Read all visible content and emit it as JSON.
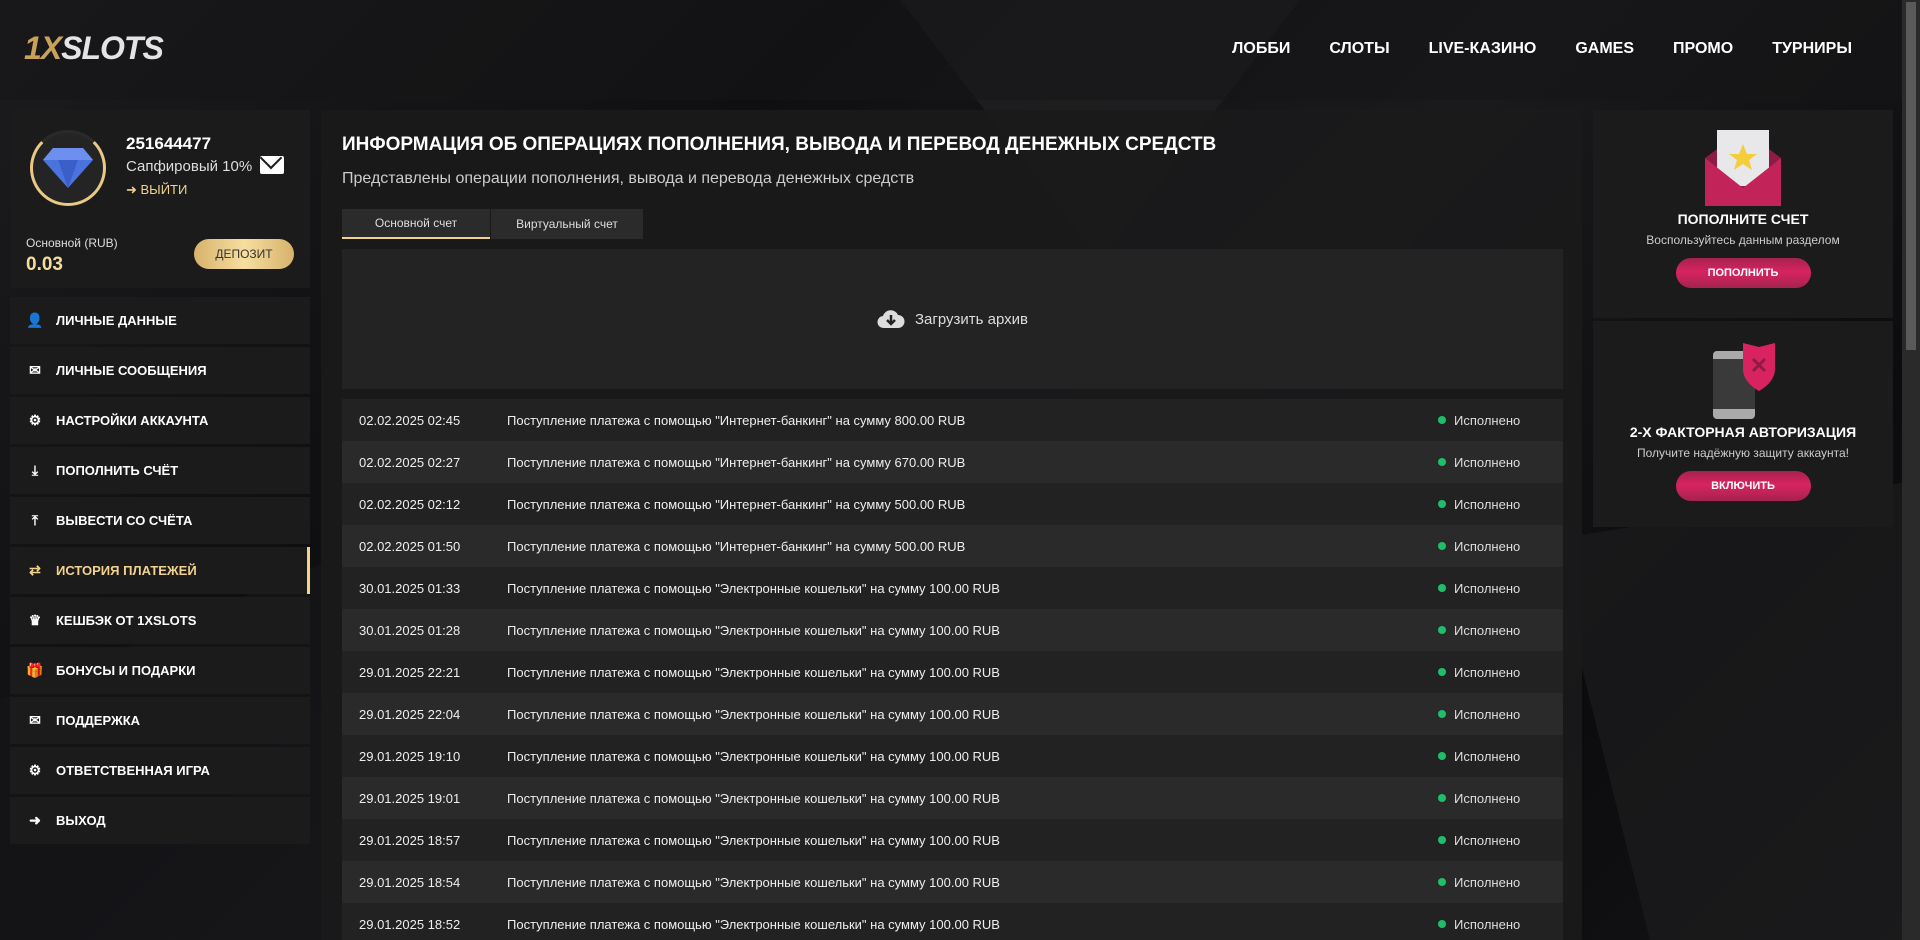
{
  "header": {
    "logo": "1XSLOTS",
    "nav": [
      "ЛОББИ",
      "СЛОТЫ",
      "LIVE-КАЗИНО",
      "GAMES",
      "ПРОМО",
      "ТУРНИРЫ"
    ]
  },
  "profile": {
    "user_id": "251644477",
    "tier": "Сапфировый 10%",
    "logout": "ВЫЙТИ",
    "balance_label": "Основной (RUB)",
    "balance": "0.03",
    "deposit": "ДЕПОЗИТ"
  },
  "menu": [
    {
      "label": "ЛИЧНЫЕ ДАННЫЕ",
      "icon": "user-plus-icon"
    },
    {
      "label": "ЛИЧНЫЕ СООБЩЕНИЯ",
      "icon": "envelope-icon"
    },
    {
      "label": "НАСТРОЙКИ АККАУНТА",
      "icon": "gears-icon"
    },
    {
      "label": "ПОПОЛНИТЬ СЧЁТ",
      "icon": "download-icon"
    },
    {
      "label": "ВЫВЕСТИ СО СЧЁТА",
      "icon": "upload-icon"
    },
    {
      "label": "ИСТОРИЯ ПЛАТЕЖЕЙ",
      "icon": "exchange-icon",
      "active": true
    },
    {
      "label": "КЕШБЭК ОТ 1XSLOTS",
      "icon": "crown-icon"
    },
    {
      "label": "БОНУСЫ И ПОДАРКИ",
      "icon": "gift-icon"
    },
    {
      "label": "ПОДДЕРЖКА",
      "icon": "envelope-icon"
    },
    {
      "label": "ОТВЕТСТВЕННАЯ ИГРА",
      "icon": "gears-icon"
    },
    {
      "label": "ВЫХОД",
      "icon": "sign-out-icon"
    }
  ],
  "main": {
    "title": "ИНФОРМАЦИЯ ОБ ОПЕРАЦИЯХ ПОПОЛНЕНИЯ, ВЫВОДА И ПЕРЕВОД ДЕНЕЖНЫХ СРЕДСТВ",
    "subtitle": "Представлены операции пополнения, вывода и перевода денежных средств",
    "tabs": [
      "Основной счет",
      "Виртуальный счет"
    ],
    "upload": "Загрузить архив",
    "rows": [
      {
        "date": "02.02.2025 02:45",
        "text": "Поступление платежа с помощью \"Интернет-банкинг\" на сумму 800.00 RUB",
        "status": "Исполнено"
      },
      {
        "date": "02.02.2025 02:27",
        "text": "Поступление платежа с помощью \"Интернет-банкинг\" на сумму 670.00 RUB",
        "status": "Исполнено"
      },
      {
        "date": "02.02.2025 02:12",
        "text": "Поступление платежа с помощью \"Интернет-банкинг\" на сумму 500.00 RUB",
        "status": "Исполнено"
      },
      {
        "date": "02.02.2025 01:50",
        "text": "Поступление платежа с помощью \"Интернет-банкинг\" на сумму 500.00 RUB",
        "status": "Исполнено"
      },
      {
        "date": "30.01.2025 01:33",
        "text": "Поступление платежа с помощью \"Электронные кошельки\" на сумму 100.00 RUB",
        "status": "Исполнено"
      },
      {
        "date": "30.01.2025 01:28",
        "text": "Поступление платежа с помощью \"Электронные кошельки\" на сумму 100.00 RUB",
        "status": "Исполнено"
      },
      {
        "date": "29.01.2025 22:21",
        "text": "Поступление платежа с помощью \"Электронные кошельки\" на сумму 100.00 RUB",
        "status": "Исполнено"
      },
      {
        "date": "29.01.2025 22:04",
        "text": "Поступление платежа с помощью \"Электронные кошельки\" на сумму 100.00 RUB",
        "status": "Исполнено"
      },
      {
        "date": "29.01.2025 19:10",
        "text": "Поступление платежа с помощью \"Электронные кошельки\" на сумму 100.00 RUB",
        "status": "Исполнено"
      },
      {
        "date": "29.01.2025 19:01",
        "text": "Поступление платежа с помощью \"Электронные кошельки\" на сумму 100.00 RUB",
        "status": "Исполнено"
      },
      {
        "date": "29.01.2025 18:57",
        "text": "Поступление платежа с помощью \"Электронные кошельки\" на сумму 100.00 RUB",
        "status": "Исполнено"
      },
      {
        "date": "29.01.2025 18:54",
        "text": "Поступление платежа с помощью \"Электронные кошельки\" на сумму 100.00 RUB",
        "status": "Исполнено"
      },
      {
        "date": "29.01.2025 18:52",
        "text": "Поступление платежа с помощью \"Электронные кошельки\" на сумму 100.00 RUB",
        "status": "Исполнено"
      }
    ]
  },
  "promo": [
    {
      "title": "ПОПОЛНИТЕ СЧЕТ",
      "text": "Воспользуйтесь данным разделом",
      "button": "ПОПОЛНИТЬ"
    },
    {
      "title": "2-Х ФАКТОРНАЯ АВТОРИЗАЦИЯ",
      "text": "Получите надёжную защиту аккаунта!",
      "button": "ВКЛЮЧИТЬ"
    }
  ],
  "colors": {
    "gold": "#f1d38d",
    "status_ok": "#1fbf6a",
    "promo_button": "#d82360"
  }
}
